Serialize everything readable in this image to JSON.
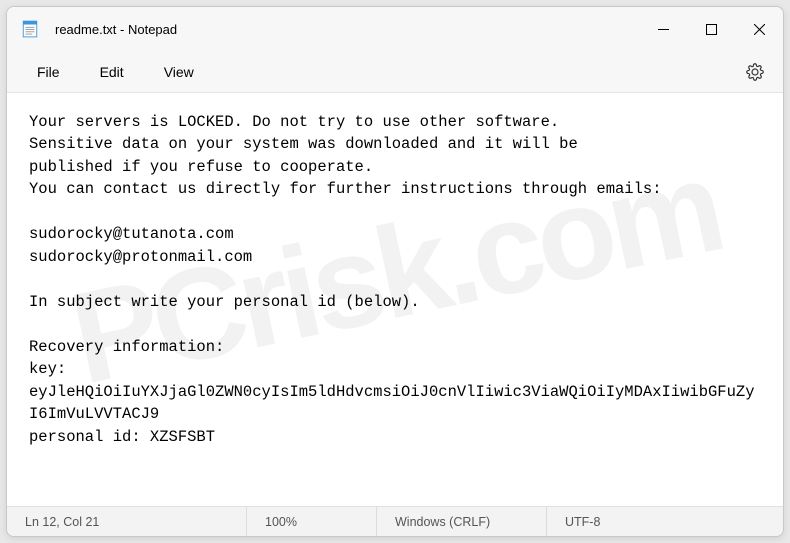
{
  "titlebar": {
    "title": "readme.txt - Notepad"
  },
  "menu": {
    "file": "File",
    "edit": "Edit",
    "view": "View"
  },
  "content": {
    "text": "Your servers is LOCKED. Do not try to use other software.\nSensitive data on your system was downloaded and it will be\npublished if you refuse to cooperate.\nYou can contact us directly for further instructions through emails:\n\nsudorocky@tutanota.com\nsudorocky@protonmail.com\n\nIn subject write your personal id (below).\n\nRecovery information:\nkey:\neyJleHQiOiIuYXJjaGl0ZWN0cyIsIm5ldHdvcmsiOiJ0cnVlIiwic3ViaWQiOiIyMDAxIiwibGFuZyI6ImVuLVVTACJ9\npersonal id: XZSFSBT"
  },
  "statusbar": {
    "position": "Ln 12, Col 21",
    "zoom": "100%",
    "line_ending": "Windows (CRLF)",
    "encoding": "UTF-8"
  }
}
